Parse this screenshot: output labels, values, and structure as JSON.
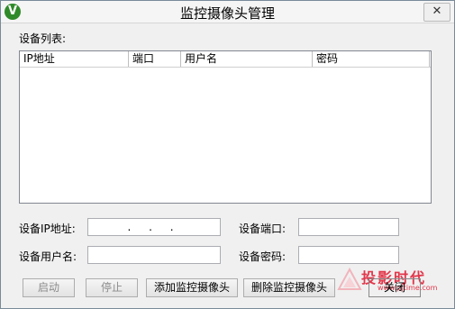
{
  "window": {
    "title": "监控摄像头管理",
    "icon_glyph": "V",
    "close_glyph": "✕"
  },
  "device_list": {
    "label": "设备列表:",
    "columns": [
      "IP地址",
      "端口",
      "用户名",
      "密码"
    ],
    "rows": []
  },
  "form": {
    "ip_label": "设备IP地址:",
    "ip_value": ". . .",
    "port_label": "设备端口:",
    "port_value": "",
    "user_label": "设备用户名:",
    "user_value": "",
    "password_label": "设备密码:",
    "password_value": ""
  },
  "buttons": {
    "start": "启动",
    "stop": "停止",
    "add": "添加监控摄像头",
    "delete": "删除监控摄像头",
    "close": "关闭"
  },
  "watermark": {
    "text": "投影时代",
    "url": "www.pjtime.com",
    "color": "#e2374b"
  }
}
